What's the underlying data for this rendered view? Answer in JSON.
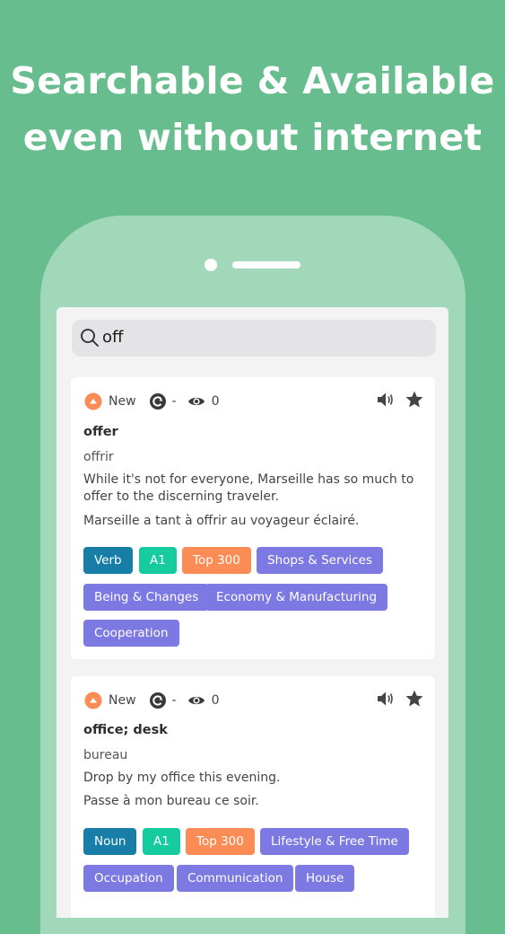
{
  "headline": {
    "line1": "Searchable & Available",
    "line2": "even without internet"
  },
  "search": {
    "value": "off"
  },
  "colors": {
    "background": "#67bd8e",
    "phone": "#a1d8ba",
    "tag_pos": "#187ea8",
    "tag_level": "#16cc9e",
    "tag_top": "#fb8c55",
    "tag_category": "#7d79e3",
    "new_badge": "#fb8c55"
  },
  "entries": [
    {
      "status": "New",
      "dash": "-",
      "views": "0",
      "word": "offer",
      "translation": "offrir",
      "example": "While it's not for everyone, Marseille has so much to offer to the discerning traveler.",
      "example_translation": "Marseille a tant à offrir au voyageur éclairé.",
      "tags": [
        "Verb",
        "A1",
        "Top 300",
        "Shops & Services",
        "Being & Changes",
        "Economy & Manufacturing",
        "Cooperation"
      ]
    },
    {
      "status": "New",
      "dash": "-",
      "views": "0",
      "word": "office; desk",
      "translation": "bureau",
      "example": "Drop by my office this evening.",
      "example_translation": "Passe à mon bureau ce soir.",
      "tags": [
        "Noun",
        "A1",
        "Top 300",
        "Lifestyle & Free Time",
        "Occupation",
        "Communication",
        "House"
      ]
    }
  ]
}
